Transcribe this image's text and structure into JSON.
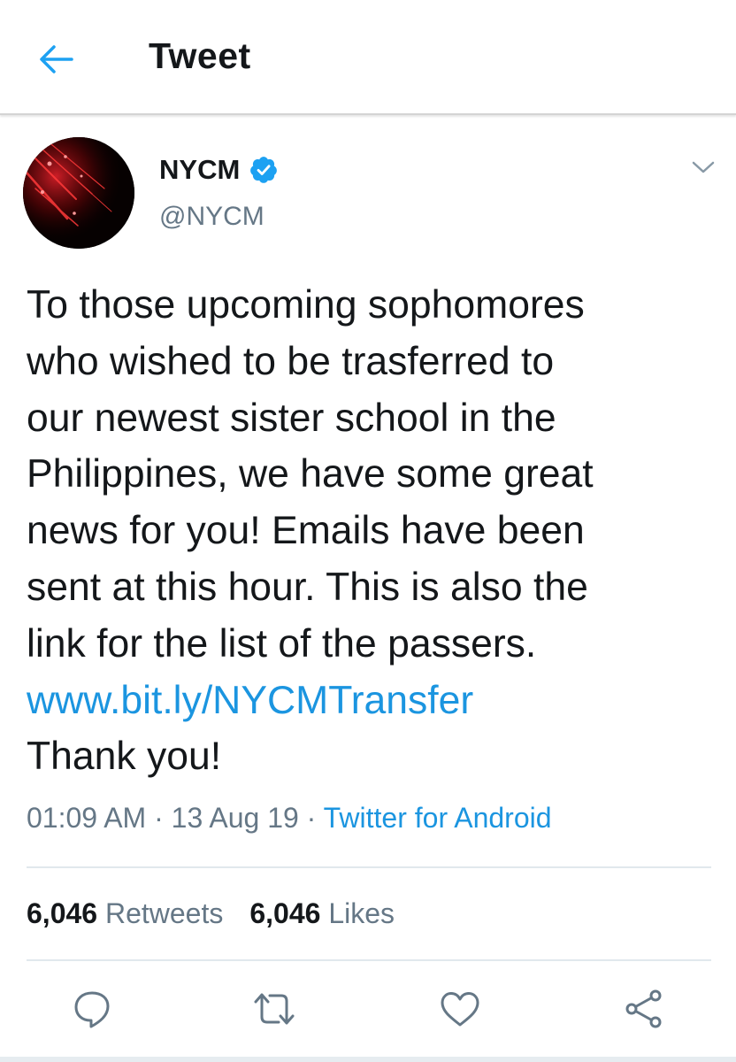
{
  "header": {
    "title": "Tweet",
    "back_icon": "arrow-left-icon",
    "accent_color": "#1da1f2"
  },
  "author": {
    "display_name": "NYCM",
    "handle": "@NYCM",
    "verified": true,
    "verified_icon": "verified-badge-icon",
    "menu_icon": "chevron-down-icon"
  },
  "tweet": {
    "lines": [
      "To those upcoming sophomores",
      "who wished to be trasferred to",
      "our newest sister school in the",
      "Philippines, we have some great",
      "news for you! Emails have been",
      "sent at this hour. This is also the",
      "link for the list of the passers."
    ],
    "link": "www.bit.ly/NYCMTransfer",
    "closing": "Thank you!",
    "link_color": "#1b95e0"
  },
  "meta": {
    "time": "01:09 AM",
    "separator": " · ",
    "date": "13 Aug 19",
    "source": "Twitter for Android"
  },
  "stats": {
    "retweets_count": "6,046",
    "retweets_label": "Retweets",
    "likes_count": "6,046",
    "likes_label": "Likes"
  },
  "actions": {
    "reply_icon": "reply-icon",
    "retweet_icon": "retweet-icon",
    "like_icon": "heart-icon",
    "share_icon": "share-icon",
    "icon_color": "#657786"
  }
}
